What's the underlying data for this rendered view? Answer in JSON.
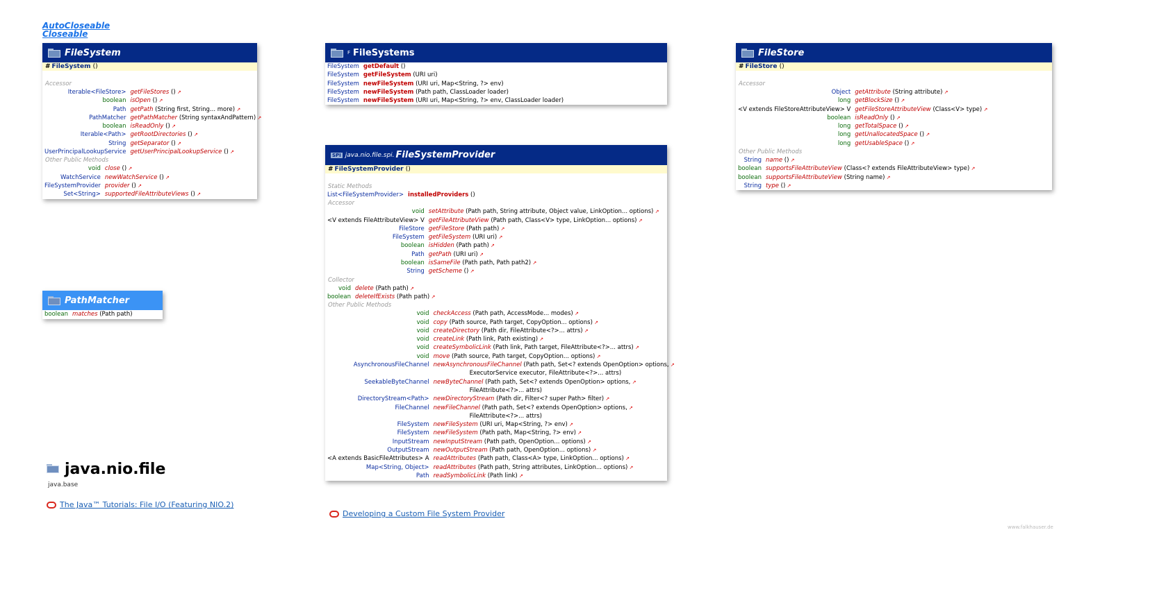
{
  "interfaces": [
    "AutoCloseable",
    "Closeable"
  ],
  "filesystem": {
    "title": "FileSystem",
    "ctor": "FileSystem",
    "ctor_args": "()",
    "accessor_label": "Accessor",
    "accessors": [
      {
        "type": "Iterable<FileStore>",
        "name": "getFileStores",
        "args": "()"
      },
      {
        "type": "boolean",
        "name": "isOpen",
        "args": "()"
      },
      {
        "type": "Path",
        "name": "getPath",
        "args": "(String first, String... more)"
      },
      {
        "type": "PathMatcher",
        "name": "getPathMatcher",
        "args": "(String syntaxAndPattern)"
      },
      {
        "type": "boolean",
        "name": "isReadOnly",
        "args": "()"
      },
      {
        "type": "Iterable<Path>",
        "name": "getRootDirectories",
        "args": "()"
      },
      {
        "type": "String",
        "name": "getSeparator",
        "args": "()"
      },
      {
        "type": "UserPrincipalLookupService",
        "name": "getUserPrincipalLookupService",
        "args": "()"
      }
    ],
    "other_label": "Other Public Methods",
    "other": [
      {
        "type": "void",
        "name": "close",
        "args": "()"
      },
      {
        "type": "WatchService",
        "name": "newWatchService",
        "args": "()"
      },
      {
        "type": "FileSystemProvider",
        "name": "provider",
        "args": "()"
      },
      {
        "type": "Set<String>",
        "name": "supportedFileAttributeViews",
        "args": "()"
      }
    ]
  },
  "filesystems": {
    "title": "FileSystems",
    "final_marker": "F",
    "methods": [
      {
        "type": "FileSystem",
        "name": "getDefault",
        "args": "()"
      },
      {
        "type": "FileSystem",
        "name": "getFileSystem",
        "args": "(URI uri)"
      },
      {
        "type": "FileSystem",
        "name": "newFileSystem",
        "args": "(URI uri, Map<String, ?> env)"
      },
      {
        "type": "FileSystem",
        "name": "newFileSystem",
        "args": "(Path path, ClassLoader loader)"
      },
      {
        "type": "FileSystem",
        "name": "newFileSystem",
        "args": "(URI uri, Map<String, ?> env, ClassLoader loader)"
      }
    ]
  },
  "filestore": {
    "title": "FileStore",
    "ctor": "FileStore",
    "ctor_args": "()",
    "accessor_label": "Accessor",
    "accessors": [
      {
        "type": "Object",
        "name": "getAttribute",
        "args": "(String attribute)"
      },
      {
        "type": "long",
        "name": "getBlockSize",
        "args": "()"
      },
      {
        "type": "<V extends FileStoreAttributeView> V",
        "name": "getFileStoreAttributeView",
        "args": "(Class<V> type)"
      },
      {
        "type": "boolean",
        "name": "isReadOnly",
        "args": "()"
      },
      {
        "type": "long",
        "name": "getTotalSpace",
        "args": "()"
      },
      {
        "type": "long",
        "name": "getUnallocatedSpace",
        "args": "()"
      },
      {
        "type": "long",
        "name": "getUsableSpace",
        "args": "()"
      }
    ],
    "other_label": "Other Public Methods",
    "other": [
      {
        "type": "String",
        "name": "name",
        "args": "()"
      },
      {
        "type": "boolean",
        "name": "supportsFileAttributeView",
        "args": "(Class<? extends FileAttributeView> type)"
      },
      {
        "type": "boolean",
        "name": "supportsFileAttributeView",
        "args": "(String name)"
      },
      {
        "type": "String",
        "name": "type",
        "args": "()"
      }
    ]
  },
  "provider": {
    "package": "java.nio.file.spi.",
    "spi_badge": "SPI",
    "title": "FileSystemProvider",
    "ctor": "FileSystemProvider",
    "ctor_args": "()",
    "static_label": "Static Methods",
    "static": [
      {
        "type": "List<FileSystemProvider>",
        "name": "installedProviders",
        "args": "()"
      }
    ],
    "accessor_label": "Accessor",
    "accessors": [
      {
        "type": "void",
        "name": "setAttribute",
        "args": "(Path path, String attribute, Object value, LinkOption... options)"
      },
      {
        "type": "<V extends FileAttributeView> V",
        "name": "getFileAttributeView",
        "args": "(Path path, Class<V> type, LinkOption... options)"
      },
      {
        "type": "FileStore",
        "name": "getFileStore",
        "args": "(Path path)"
      },
      {
        "type": "FileSystem",
        "name": "getFileSystem",
        "args": "(URI uri)"
      },
      {
        "type": "boolean",
        "name": "isHidden",
        "args": "(Path path)"
      },
      {
        "type": "Path",
        "name": "getPath",
        "args": "(URI uri)"
      },
      {
        "type": "boolean",
        "name": "isSameFile",
        "args": "(Path path, Path path2)"
      },
      {
        "type": "String",
        "name": "getScheme",
        "args": "()"
      }
    ],
    "collector_label": "Collector",
    "collector": [
      {
        "type": "void",
        "name": "delete",
        "args": "(Path path)"
      },
      {
        "type": "boolean",
        "name": "deleteIfExists",
        "args": "(Path path)"
      }
    ],
    "other_label": "Other Public Methods",
    "other": [
      {
        "type": "void",
        "name": "checkAccess",
        "args": "(Path path, AccessMode... modes)"
      },
      {
        "type": "void",
        "name": "copy",
        "args": "(Path source, Path target, CopyOption... options)"
      },
      {
        "type": "void",
        "name": "createDirectory",
        "args": "(Path dir, FileAttribute<?>... attrs)"
      },
      {
        "type": "void",
        "name": "createLink",
        "args": "(Path link, Path existing)"
      },
      {
        "type": "void",
        "name": "createSymbolicLink",
        "args": "(Path link, Path target, FileAttribute<?>... attrs)"
      },
      {
        "type": "void",
        "name": "move",
        "args": "(Path source, Path target, CopyOption... options)"
      },
      {
        "type": "AsynchronousFileChannel",
        "name": "newAsynchronousFileChannel",
        "args": "(Path path, Set<? extends OpenOption> options,",
        "cont": "ExecutorService executor, FileAttribute<?>... attrs)"
      },
      {
        "type": "SeekableByteChannel",
        "name": "newByteChannel",
        "args": "(Path path, Set<? extends OpenOption> options,",
        "cont": "FileAttribute<?>... attrs)"
      },
      {
        "type": "DirectoryStream<Path>",
        "name": "newDirectoryStream",
        "args": "(Path dir, Filter<? super Path> filter)"
      },
      {
        "type": "FileChannel",
        "name": "newFileChannel",
        "args": "(Path path, Set<? extends OpenOption> options,",
        "cont": "FileAttribute<?>... attrs)"
      },
      {
        "type": "FileSystem",
        "name": "newFileSystem",
        "args": "(URI uri, Map<String, ?> env)"
      },
      {
        "type": "FileSystem",
        "name": "newFileSystem",
        "args": "(Path path, Map<String, ?> env)"
      },
      {
        "type": "InputStream",
        "name": "newInputStream",
        "args": "(Path path, OpenOption... options)"
      },
      {
        "type": "OutputStream",
        "name": "newOutputStream",
        "args": "(Path path, OpenOption... options)"
      },
      {
        "type": "<A extends BasicFileAttributes> A",
        "name": "readAttributes",
        "args": "(Path path, Class<A> type, LinkOption... options)"
      },
      {
        "type": "Map<String, Object>",
        "name": "readAttributes",
        "args": "(Path path, String attributes, LinkOption... options)"
      },
      {
        "type": "Path",
        "name": "readSymbolicLink",
        "args": "(Path link)"
      }
    ]
  },
  "pathmatcher": {
    "title": "PathMatcher",
    "methods": [
      {
        "type": "boolean",
        "name": "matches",
        "args": "(Path path)"
      }
    ]
  },
  "package": {
    "name": "java.nio.file",
    "module": "java.base"
  },
  "links": {
    "tutorial": "The Java™ Tutorials: File I/O (Featuring NIO.2)",
    "provider_guide": "Developing a Custom File System Provider"
  },
  "credit": "www.falkhauser.de"
}
